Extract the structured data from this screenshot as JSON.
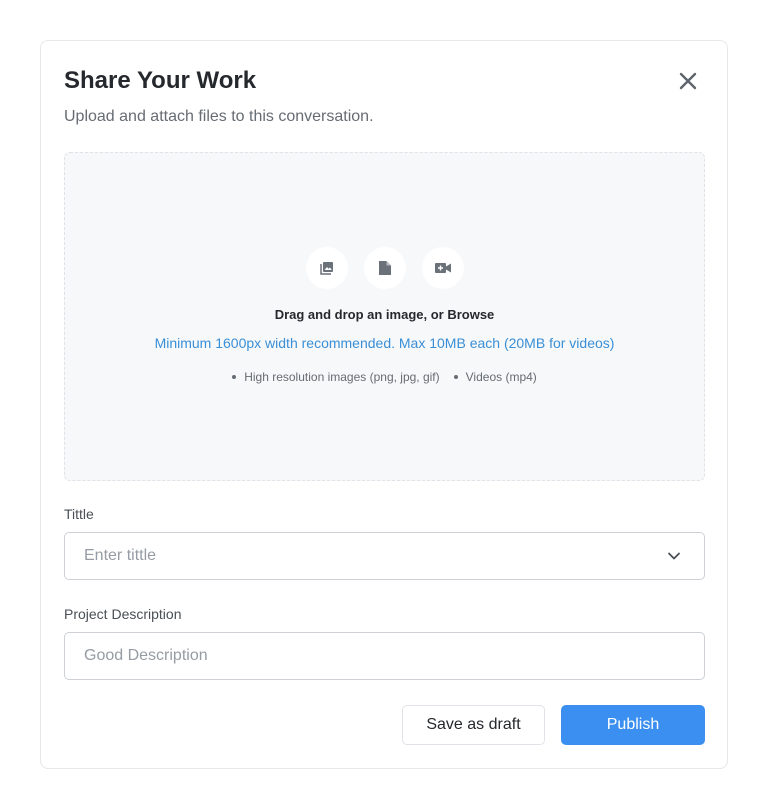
{
  "modal": {
    "title": "Share Your Work",
    "subtitle": "Upload and attach files to this conversation.",
    "close_icon": "close-icon"
  },
  "dropzone": {
    "icons": [
      "image-icon",
      "document-icon",
      "video-camera-icon"
    ],
    "heading": "Drag and drop an image, or Browse",
    "hint": "Minimum 1600px width recommended. Max 10MB each (20MB for videos)",
    "bullets": [
      "High resolution images (png, jpg, gif)",
      "Videos (mp4)"
    ]
  },
  "title_field": {
    "label": "Tittle",
    "placeholder": "Enter tittle",
    "value": ""
  },
  "description_field": {
    "label": "Project Description",
    "placeholder": "Good Description",
    "value": ""
  },
  "actions": {
    "draft_label": "Save as draft",
    "publish_label": "Publish"
  },
  "colors": {
    "accent": "#3b8ff0",
    "hint_text": "#3a8fd6",
    "dropzone_bg": "#f7f8f9"
  }
}
